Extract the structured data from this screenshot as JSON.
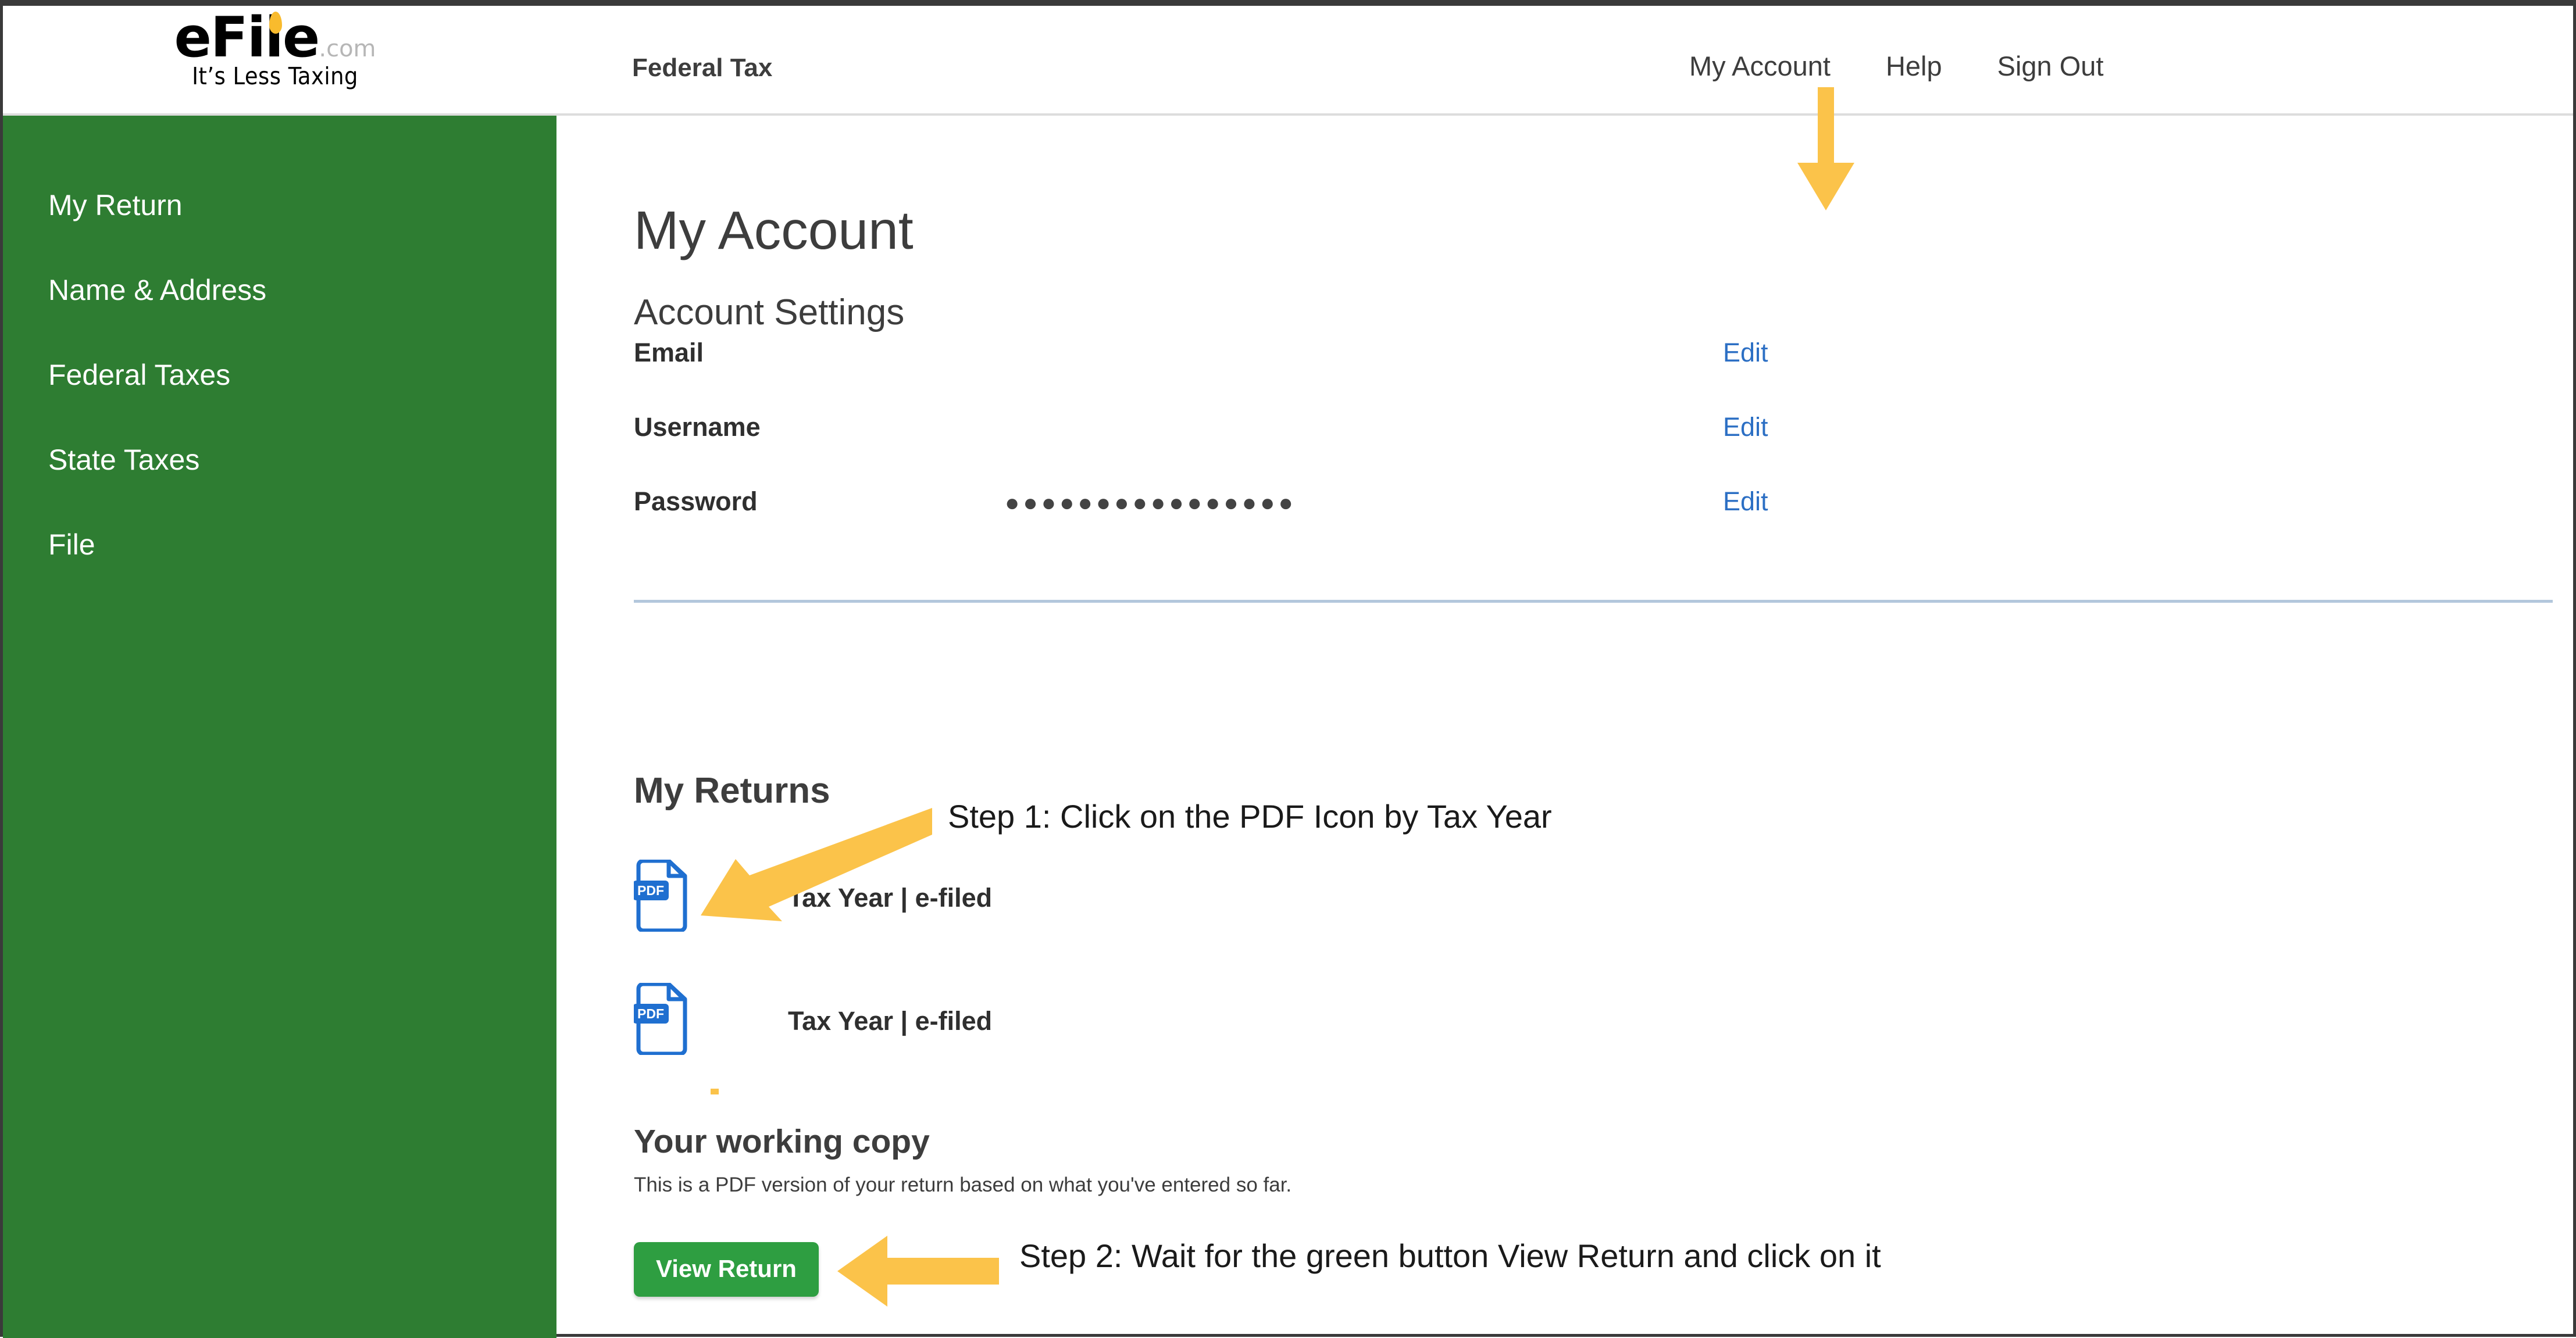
{
  "brand": {
    "logo_main": "eFile",
    "logo_suffix": ".com",
    "tagline": "It’s Less Taxing",
    "sidebar_color": "#2e7d32",
    "accent_yellow": "#fbc34a",
    "link_blue": "#2c6fc4",
    "button_green": "#2e9e41"
  },
  "header": {
    "title": "Federal Tax",
    "nav": [
      {
        "label": "My Account",
        "name": "my-account"
      },
      {
        "label": "Help",
        "name": "help"
      },
      {
        "label": "Sign Out",
        "name": "sign-out"
      }
    ]
  },
  "sidebar": {
    "items": [
      {
        "label": "My Return"
      },
      {
        "label": "Name & Address"
      },
      {
        "label": "Federal Taxes"
      },
      {
        "label": "State Taxes"
      },
      {
        "label": "File"
      }
    ]
  },
  "main": {
    "page_title": "My Account",
    "account_settings": {
      "heading": "Account Settings",
      "rows": [
        {
          "label": "Email",
          "value": "",
          "edit_label": "Edit",
          "redacted": true
        },
        {
          "label": "Username",
          "value": "",
          "edit_label": "Edit",
          "redacted": true
        },
        {
          "label": "Password",
          "value": "●●●●●●●●●●●●●●●●",
          "edit_label": "Edit",
          "redacted": false
        }
      ]
    },
    "my_returns": {
      "heading": "My Returns",
      "rows": [
        {
          "icon": "pdf-icon",
          "year": "",
          "label": "Tax Year | e-filed"
        },
        {
          "icon": "pdf-icon",
          "year": "",
          "label": "Tax Year | e-filed"
        }
      ]
    },
    "working_copy": {
      "title": "Your working copy",
      "description": "This is a PDF version of your return based on what you've entered so far.",
      "button_label": "View Return"
    }
  },
  "annotations": [
    {
      "id": "step1",
      "text": "Step 1: Click on the PDF Icon by Tax Year",
      "arrow": "arrow-left-up"
    },
    {
      "id": "step2",
      "text": "Step 2: Wait for the green button View Return and click on it",
      "arrow": "arrow-left"
    },
    {
      "id": "my-account-pointer",
      "text": "",
      "arrow": "arrow-down"
    }
  ]
}
